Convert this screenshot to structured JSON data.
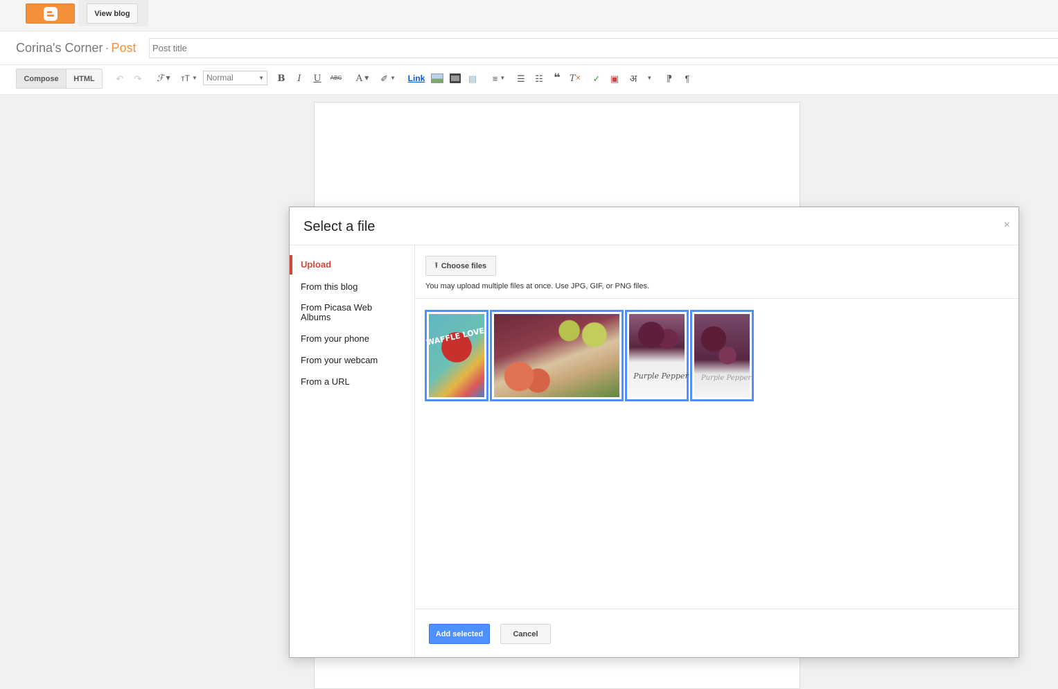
{
  "topbar": {
    "logo_icon": "blogger-logo-icon",
    "view_blog_label": "View blog"
  },
  "title_row": {
    "blog_name": "Corina's Corner",
    "separator": "·",
    "section": "Post",
    "post_title_placeholder": "Post title",
    "post_title_value": ""
  },
  "toolbar": {
    "compose_label": "Compose",
    "html_label": "HTML",
    "font_size_value": "Normal",
    "link_label": "Link",
    "icons": [
      "undo-icon",
      "redo-icon",
      "font-family-icon",
      "font-size-icon",
      "bold-icon",
      "italic-icon",
      "underline-icon",
      "strikethrough-icon",
      "text-color-icon",
      "highlight-icon",
      "insert-image-icon",
      "insert-video-icon",
      "insert-jump-break-icon",
      "align-icon",
      "numbered-list-icon",
      "bullet-list-icon",
      "quote-icon",
      "remove-formatting-icon",
      "spellcheck-icon",
      "insert-special-icon",
      "input-tools-icon",
      "ltr-icon",
      "rtl-icon"
    ]
  },
  "dialog": {
    "title": "Select a file",
    "close_label": "×",
    "sidebar": [
      {
        "label": "Upload",
        "active": true
      },
      {
        "label": "From this blog"
      },
      {
        "label": "From Picasa Web Albums"
      },
      {
        "label": "From your phone"
      },
      {
        "label": "From your webcam"
      },
      {
        "label": "From a URL"
      }
    ],
    "choose_files_label": "Choose files",
    "hint": "You may upload multiple files at once. Use JPG, GIF, or PNG files.",
    "thumbnails": [
      {
        "name": "waffle-love-image",
        "overlay": "WAFFLE LOVE"
      },
      {
        "name": "fruit-boxes-image",
        "overlay": ""
      },
      {
        "name": "purple-pepper-image-1",
        "overlay": "Purple Pepper"
      },
      {
        "name": "purple-pepper-image-2",
        "overlay": "Purple Pepper"
      }
    ],
    "add_selected_label": "Add selected",
    "cancel_label": "Cancel",
    "colors": {
      "accent_red": "#d14836",
      "selection_blue": "#4d90fe",
      "blogger_orange": "#f48f3a"
    }
  }
}
